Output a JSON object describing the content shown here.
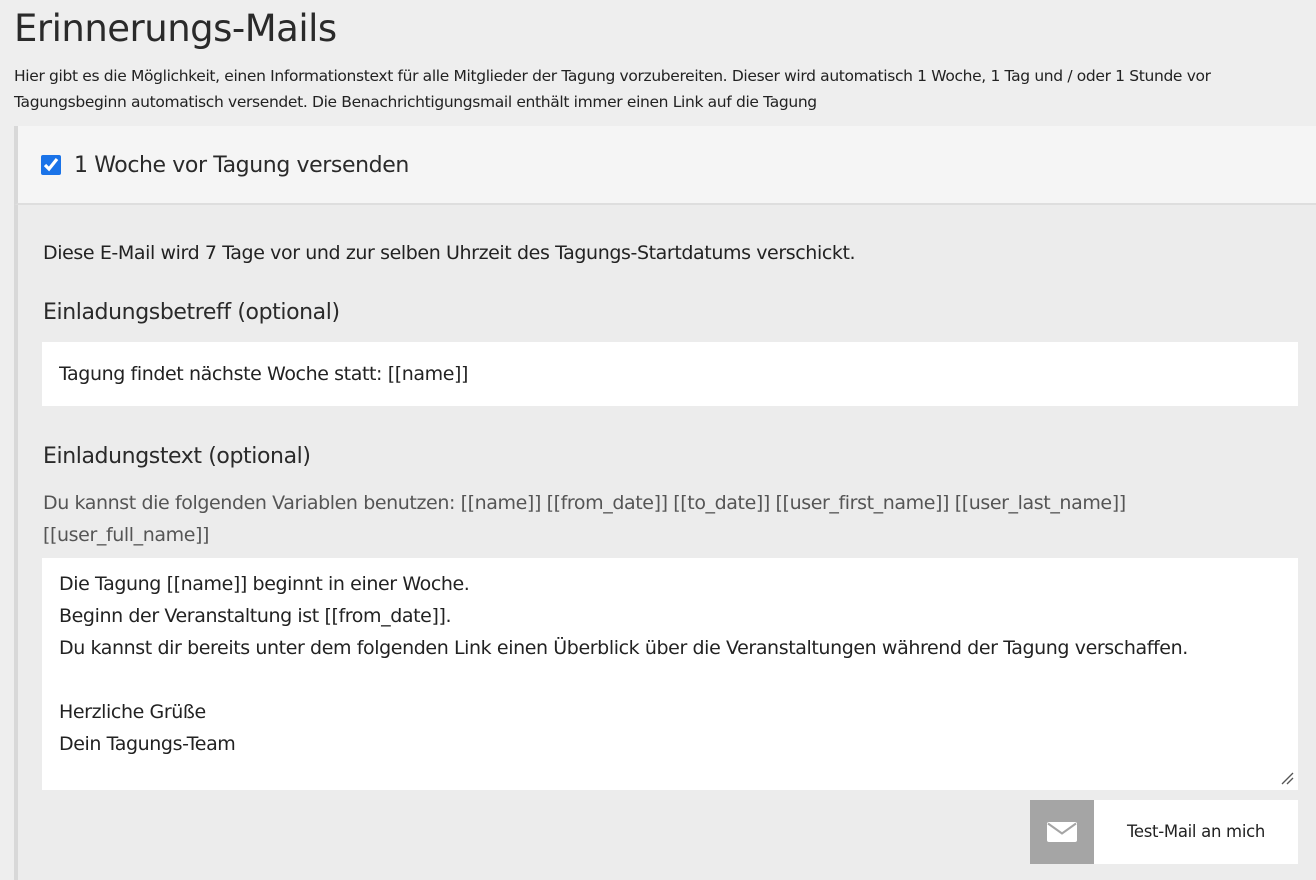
{
  "page": {
    "title": "Erinnerungs-Mails",
    "intro": "Hier gibt es die Möglichkeit, einen Informationstext für alle Mitglieder der Tagung vorzubereiten. Dieser wird automatisch 1 Woche, 1 Tag und / oder 1 Stunde vor Tagungsbeginn automatisch versendet. Die Benachrichtigungsmail enthält immer einen Link auf die Tagung"
  },
  "reminder": {
    "enabled": true,
    "header_label": "1 Woche vor Tagung versenden",
    "schedule_info": "Diese E-Mail wird 7 Tage vor und zur selben Uhrzeit des Tagungs-Startdatums verschickt.",
    "subject": {
      "label": "Einladungsbetreff (optional)",
      "value": "Tagung findet nächste Woche statt: [[name]]"
    },
    "body": {
      "label": "Einladungstext (optional)",
      "variables_hint": "Du kannst die folgenden Variablen benutzen: [[name]] [[from_date]] [[to_date]] [[user_first_name]] [[user_last_name]] [[user_full_name]]",
      "value": "Die Tagung [[name]] beginnt in einer Woche.\nBeginn der Veranstaltung ist [[from_date]].\nDu kannst dir bereits unter dem folgenden Link einen Überblick über die Veranstaltungen während der Tagung verschaffen.\n\nHerzliche Grüße\nDein Tagungs-Team"
    },
    "test_mail": {
      "label": "Test-Mail an mich",
      "icon": "envelope-icon"
    }
  },
  "colors": {
    "background": "#eeeeee",
    "panel_header": "#f5f5f5",
    "field_background": "#ffffff",
    "icon_box": "#a5a5a5",
    "checkbox_accent": "#1a73e8"
  }
}
